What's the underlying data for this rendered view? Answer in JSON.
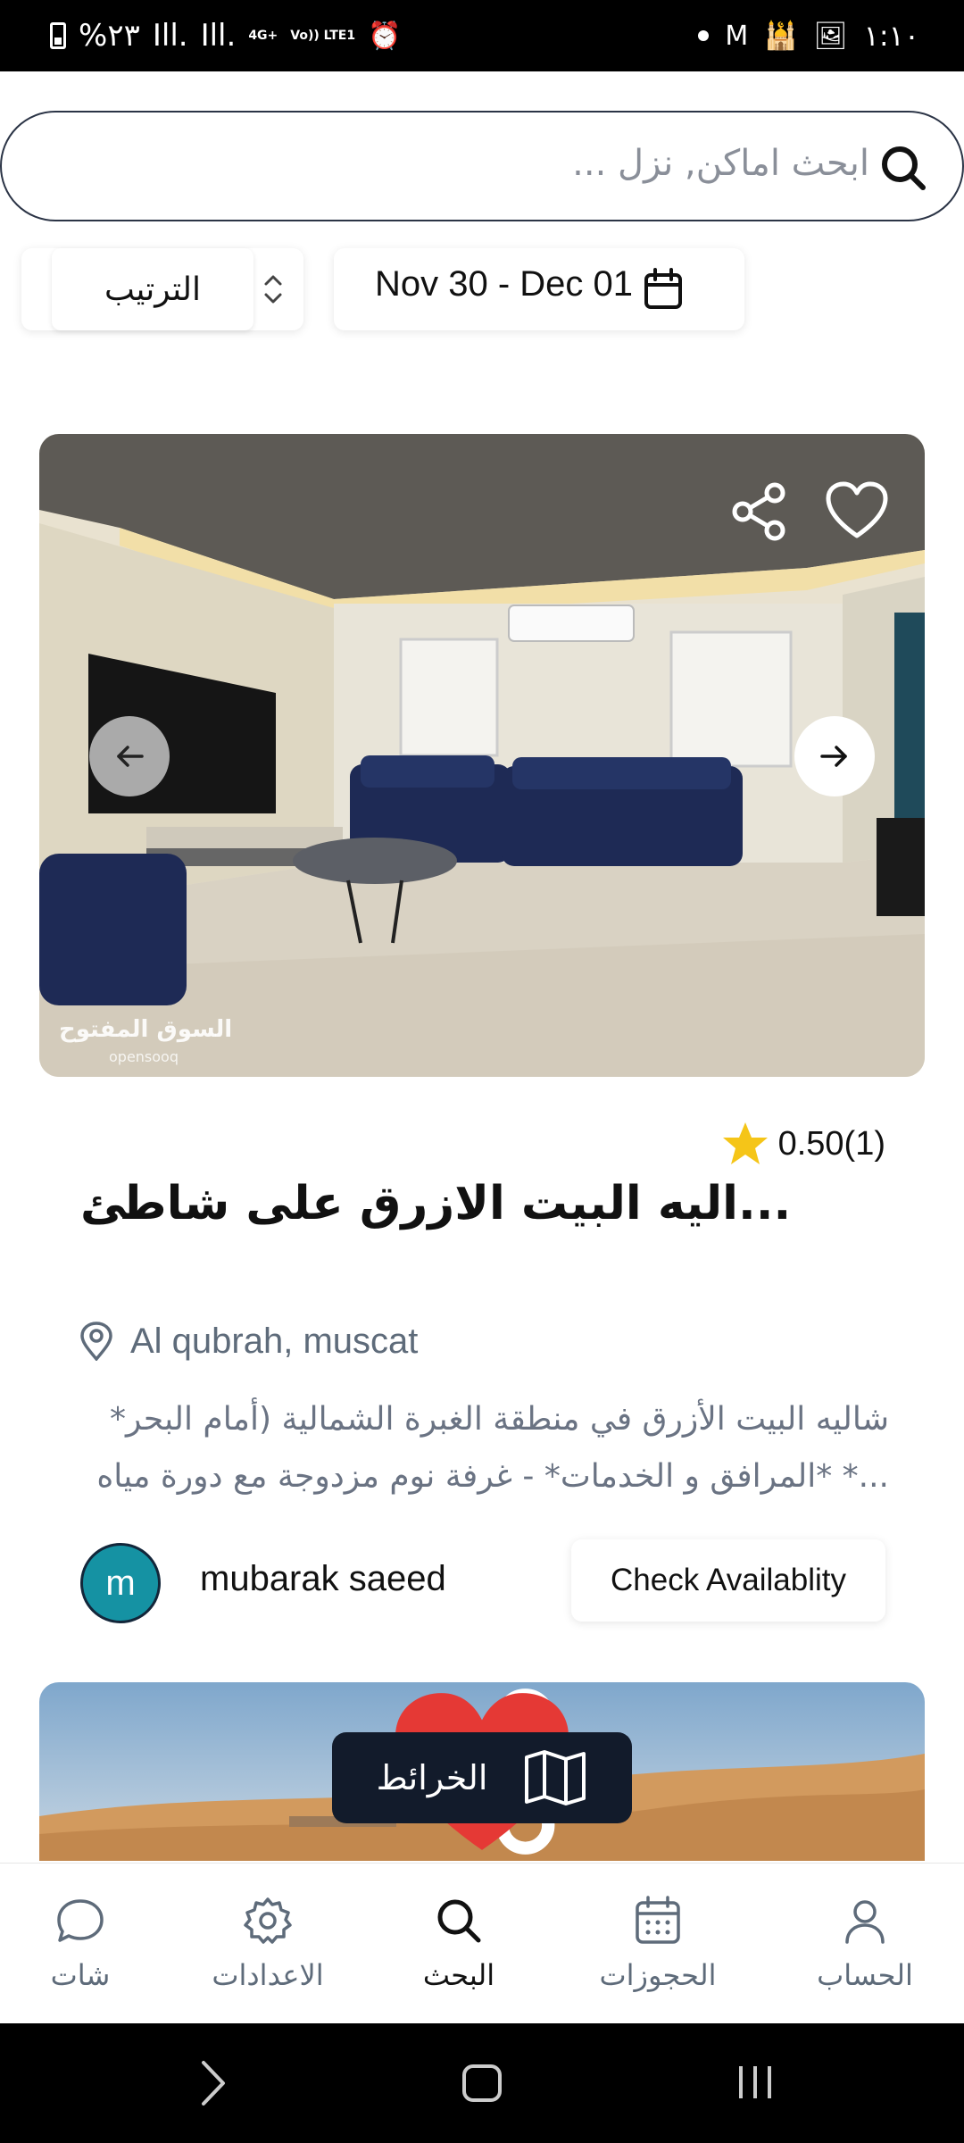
{
  "status_bar": {
    "battery": "%٢٣",
    "signal_1": "Ill.",
    "signal_2": "Ill.",
    "network_1": "4G+",
    "network_2": "Vo)) LTE1",
    "time": "١:١٠",
    "icons": [
      "battery-icon",
      "signal-icon",
      "alarm-icon",
      "gmail-icon",
      "mosque-icon",
      "gallery-icon"
    ]
  },
  "search": {
    "placeholder": "ابحث اماكن, نزل ..."
  },
  "filters": {
    "sort_label": "الترتيب",
    "date_range": "Nov 30 - Dec 01"
  },
  "listing": {
    "rating": "0.50(1)",
    "title": "...اليه البيت الازرق على شاطئ",
    "location": "Al qubrah, muscat",
    "description_line1": "شاليه البيت الأزرق في منطقة الغبرة الشمالية (أمام البحر*",
    "description_line2": "...* *المرافق و الخدمات* - غرفة نوم مزدوجة مع دورة مياه",
    "host_initial": "m",
    "host_name": "mubarak saeed",
    "check_label": "Check Availablity",
    "watermark": "السوق المفتوح",
    "watermark_sub": "opensooq",
    "favorited": false
  },
  "listing2": {
    "favorited": true
  },
  "maps_button": {
    "label": "الخرائط"
  },
  "bottom_nav": {
    "chat": "شات",
    "settings": "الاعدادات",
    "search": "البحث",
    "bookings": "الحجوزات",
    "account": "الحساب",
    "active": "search"
  },
  "colors": {
    "accent_dark": "#121b2b",
    "avatar_bg": "#1592a3",
    "heart_active": "#e53935",
    "star": "#f5c518",
    "muted_text": "#5e6b7a"
  }
}
